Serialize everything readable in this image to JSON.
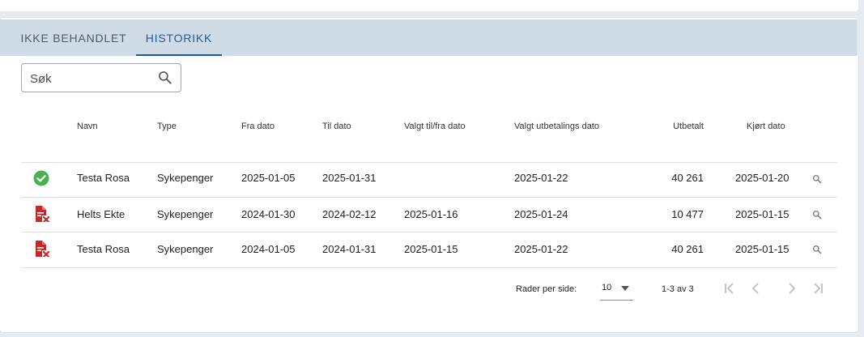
{
  "tabs": [
    {
      "label": "IKKE BEHANDLET"
    },
    {
      "label": "HISTORIKK"
    }
  ],
  "search": {
    "placeholder": "Søk"
  },
  "table": {
    "headers": [
      "Navn",
      "Type",
      "Fra dato",
      "Til dato",
      "Valgt til/fra dato",
      "Valgt utbetalings dato",
      "Utbetalt",
      "Kjørt dato"
    ],
    "rows": [
      {
        "status": "check-circle-icon",
        "navn": "Testa Rosa",
        "type": "Sykepenger",
        "fra": "2025-01-05",
        "til": "2025-01-31",
        "valgt": "",
        "utbetalingsdato": "2025-01-22",
        "utbetalt": "40 261",
        "kjort": "2025-01-20"
      },
      {
        "status": "document-error-icon",
        "navn": "Helts Ekte",
        "type": "Sykepenger",
        "fra": "2024-01-30",
        "til": "2024-02-12",
        "valgt": "2025-01-16",
        "utbetalingsdato": "2025-01-24",
        "utbetalt": "10 477",
        "kjort": "2025-01-15"
      },
      {
        "status": "document-error-icon",
        "navn": "Testa Rosa",
        "type": "Sykepenger",
        "fra": "2024-01-05",
        "til": "2024-01-31",
        "valgt": "2025-01-15",
        "utbetalingsdato": "2025-01-22",
        "utbetalt": "40 261",
        "kjort": "2025-01-15"
      }
    ]
  },
  "pagination": {
    "rows_per_page_label": "Rader per side:",
    "rows_per_page": "10",
    "range": "1-3 av 3"
  },
  "colors": {
    "accent": "#1f5c95",
    "success": "#4caf50",
    "error": "#c62828",
    "tabbar": "#cfdbe6"
  }
}
